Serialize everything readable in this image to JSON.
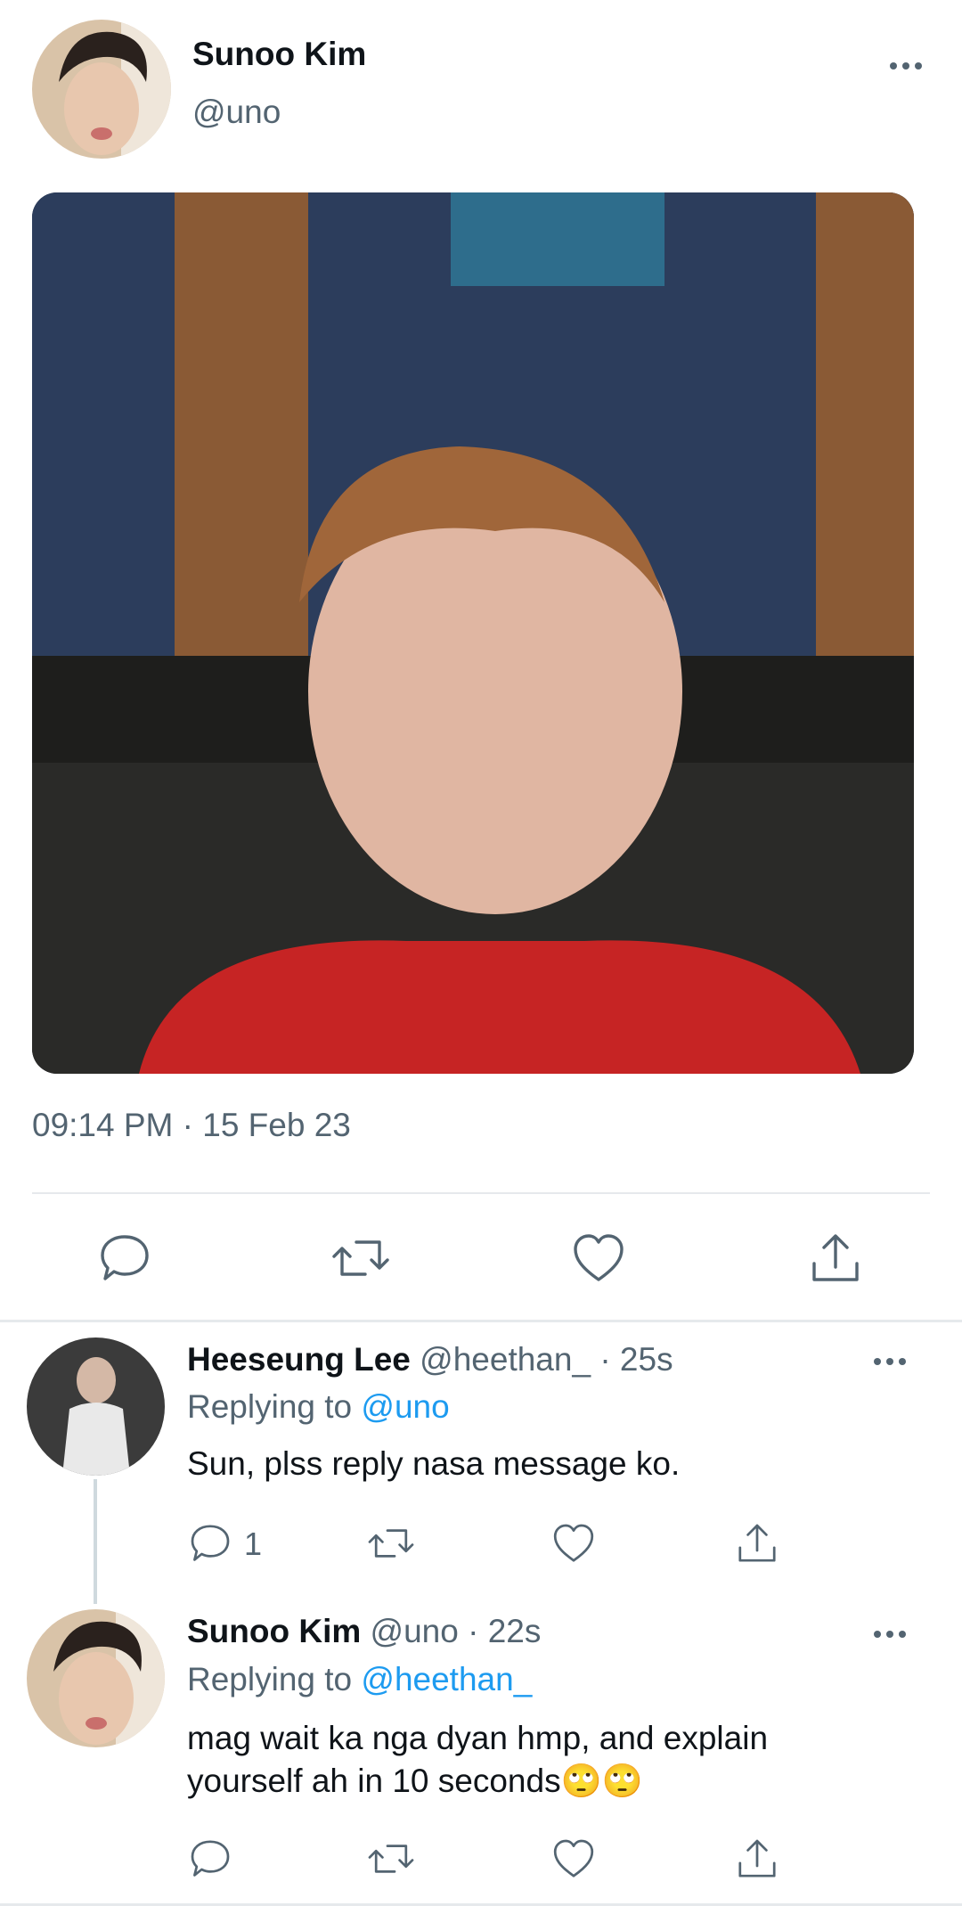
{
  "tweet": {
    "author_name": "Sunoo Kim",
    "author_handle": "@uno",
    "timestamp": "09:14 PM · 15 Feb 23"
  },
  "replies": [
    {
      "name": "Heeseung Lee",
      "meta": "@heethan_ · 25s",
      "replying_prefix": "Replying to ",
      "replying_handle": "@uno",
      "text": "Sun, plss reply nasa message ko.",
      "reply_count": "1"
    },
    {
      "name": "Sunoo Kim",
      "meta": "@uno · 22s",
      "replying_prefix": "Replying to ",
      "replying_handle": "@heethan_",
      "text_line1": "mag wait ka nga dyan hmp, and explain",
      "text_line2": "yourself ah in 10 seconds",
      "emoji": "🙄🙄"
    }
  ],
  "icons": [
    "reply-icon",
    "retweet-icon",
    "like-icon",
    "share-icon",
    "more-icon"
  ],
  "colors": {
    "link": "#1d9bf0",
    "secondary": "#536471",
    "divider": "#e6e9ec"
  }
}
